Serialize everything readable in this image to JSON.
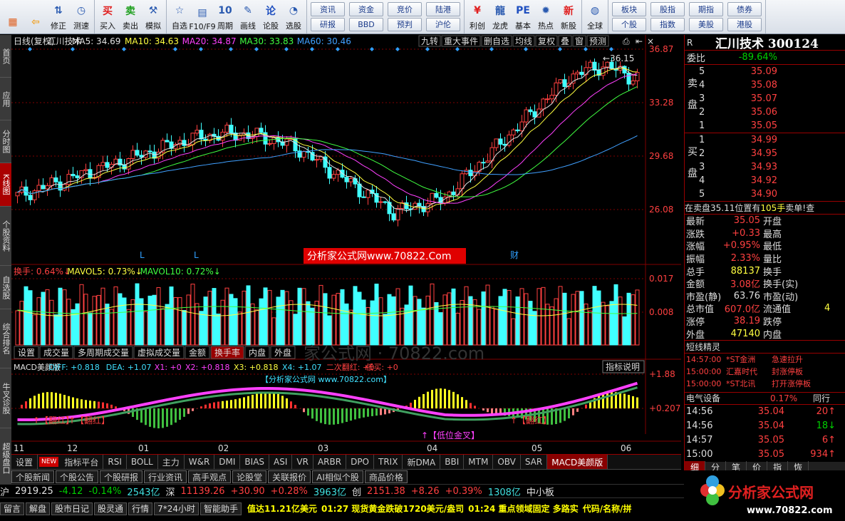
{
  "toolbar": {
    "buttons": [
      {
        "icon": "home-icon",
        "label": ""
      },
      {
        "icon": "back-icon",
        "label": ""
      },
      {
        "icon": "up-down-icon",
        "label": "修正"
      },
      {
        "icon": "test-icon",
        "label": "测速"
      },
      {
        "icon": "buy-icon",
        "label": "买入",
        "glyph": "买"
      },
      {
        "icon": "sell-icon",
        "label": "卖出",
        "glyph": "卖"
      },
      {
        "icon": "hammer-icon",
        "label": "模拟"
      },
      {
        "icon": "star-folder-icon",
        "label": "自选"
      },
      {
        "icon": "f10-icon",
        "label": "F10/F9"
      },
      {
        "icon": "calendar-icon",
        "label": "周期",
        "glyph": "10"
      },
      {
        "icon": "pencil-icon",
        "label": "画线"
      },
      {
        "icon": "forum-icon",
        "label": "论股",
        "glyph": "论"
      },
      {
        "icon": "chart-select-icon",
        "label": "选股"
      }
    ],
    "small_buttons": [
      [
        "资讯",
        "研报"
      ],
      [
        "资金",
        "BBD"
      ],
      [
        "竞价",
        "预判"
      ],
      [
        "陆港",
        "沪伦"
      ]
    ],
    "buttons2": [
      {
        "icon": "money-icon",
        "label": "利创",
        "glyph": "¥"
      },
      {
        "icon": "dragon-icon",
        "label": "龙虎"
      },
      {
        "icon": "pe-icon",
        "label": "基本",
        "glyph": "PE"
      },
      {
        "icon": "hot-icon",
        "label": "热点"
      },
      {
        "icon": "new-icon",
        "label": "新股",
        "glyph": "新"
      },
      {
        "icon": "globe-icon",
        "label": "全球"
      }
    ],
    "small_buttons2": [
      [
        "板块",
        "个股"
      ],
      [
        "股指",
        "指数"
      ],
      [
        "期指",
        "美股"
      ],
      [
        "债券",
        "港股"
      ]
    ]
  },
  "left_tabs": [
    "首页",
    "应用",
    "分时图",
    "K线图",
    "个股资料",
    "自选股",
    "综合排名",
    "牛叉诊股",
    "超级盘口"
  ],
  "chart": {
    "ma_line": [
      {
        "text": "日线(复权)",
        "color": "#e0e0e0"
      },
      {
        "text": "汇川技术",
        "color": "#e0e0e0"
      },
      {
        "text": "MA5: 34.69",
        "color": "#e0e0e0"
      },
      {
        "text": "MA10: 34.63",
        "color": "#ffff40"
      },
      {
        "text": "MA20: 34.87",
        "color": "#ff40ff"
      },
      {
        "text": "MA30: 33.83",
        "color": "#40ff40"
      },
      {
        "text": "MA60: 30.46",
        "color": "#40a0ff"
      }
    ],
    "top_buttons": [
      "九转",
      "重大事件",
      "删自选",
      "均线",
      "复权",
      "叠",
      "窗",
      "预测"
    ],
    "price_ticks": [
      "36.87",
      "33.28",
      "29.68",
      "26.08"
    ],
    "high_label": "36.15",
    "watermark": "分析家公式网www.70822.Com",
    "watermark2": "分析家公式网 www.70822.com",
    "markers": [
      "L",
      "L",
      "财"
    ],
    "vol_line": [
      {
        "text": "换手: 0.64%",
        "color": "#ff4040"
      },
      {
        "text": "MAVOL5: 0.73%",
        "color": "#ffff40"
      },
      {
        "text": "MAVOL10: 0.72%",
        "color": "#40ff40"
      }
    ],
    "vol_ticks": [
      "0.017",
      "0.008"
    ],
    "vol_tabs": [
      "设置",
      "成交量",
      "多周期成交量",
      "虚拟成交量",
      "金额",
      "换手率",
      "内盘",
      "外盘"
    ],
    "vol_tab_selected": "换手率",
    "macd_line": [
      {
        "text": "MACD美颜版",
        "color": "#e0e0e0"
      },
      {
        "text": "DIFF: +0.818",
        "color": "#40e0ff"
      },
      {
        "text": "DEA: +1.07",
        "color": "#40e0ff"
      },
      {
        "text": "X1: +0",
        "color": "#ff40ff"
      },
      {
        "text": "X2: +0.818",
        "color": "#ff40ff"
      },
      {
        "text": "X3: +0.818",
        "color": "#ffff40"
      },
      {
        "text": "X4: +1.07",
        "color": "#40e0ff"
      },
      {
        "text": "二次翻红: +0",
        "color": "#ff4040"
      },
      {
        "text": "低买: +0",
        "color": "#ff4040"
      }
    ],
    "macd_help": "指标说明",
    "macd_ticks": [
      "+1.88",
      "+0.207"
    ],
    "macd_labels": [
      "【翻红】",
      "【翻红】",
      "【低位金叉】",
      "【翻红】"
    ],
    "date_ticks": [
      "11",
      "12",
      "01",
      "02",
      "03",
      "04",
      "05",
      "06"
    ]
  },
  "indicator_tabs": [
    "设置",
    "NEW",
    "指标平台",
    "RSI",
    "BOLL",
    "主力",
    "W&R",
    "DMI",
    "BIAS",
    "ASI",
    "VR",
    "ARBR",
    "DPO",
    "TRIX",
    "新DMA",
    "BBI",
    "MTM",
    "OBV",
    "SAR",
    "MACD美颜版"
  ],
  "indicator_selected": "MACD美颜版",
  "news_tabs": [
    "个股新闻",
    "个股公告",
    "个股研报",
    "行业资讯",
    "高手观点",
    "论股堂",
    "关联报价",
    "AI相似个股",
    "商品价格"
  ],
  "index_bar": [
    {
      "text": "沪",
      "color": "#e0e0e0"
    },
    {
      "text": "2919.25",
      "color": "#e0e0e0"
    },
    {
      "text": "-4.12",
      "color": "#00d000"
    },
    {
      "text": "-0.14%",
      "color": "#00d000"
    },
    {
      "text": "2543亿",
      "color": "#40e0e0"
    },
    {
      "text": "深",
      "color": "#e0e0e0"
    },
    {
      "text": "11139.26",
      "color": "#ff4040"
    },
    {
      "text": "+30.90",
      "color": "#ff4040"
    },
    {
      "text": "+0.28%",
      "color": "#ff4040"
    },
    {
      "text": "3963亿",
      "color": "#40e0e0"
    },
    {
      "text": "创",
      "color": "#e0e0e0"
    },
    {
      "text": "2151.38",
      "color": "#ff4040"
    },
    {
      "text": "+8.26",
      "color": "#ff4040"
    },
    {
      "text": "+0.39%",
      "color": "#ff4040"
    },
    {
      "text": "1308亿",
      "color": "#40e0e0"
    },
    {
      "text": "中小板",
      "color": "#e0e0e0"
    }
  ],
  "bottom_bar": {
    "buttons": [
      "留言",
      "解盘",
      "股市日记",
      "股灵通",
      "行情",
      "7*24小时",
      "智能助手"
    ],
    "ticker": [
      "值达11.21亿美元",
      "01:27 现货黄金跌破1720美元/盎司",
      "01:24 重点领域固定 多路实",
      "代码/名称/拼"
    ]
  },
  "quote": {
    "title": "汇川技术 300124",
    "r_label": "R",
    "weibi_label": "委比",
    "weibi": "-89.64%",
    "sell_label": "卖盘",
    "sell": [
      {
        "lv": "5",
        "p": "35.09"
      },
      {
        "lv": "4",
        "p": "35.08"
      },
      {
        "lv": "3",
        "p": "35.07"
      },
      {
        "lv": "2",
        "p": "35.06"
      },
      {
        "lv": "1",
        "p": "35.05"
      }
    ],
    "buy_label": "买盘",
    "buy": [
      {
        "lv": "1",
        "p": "34.99"
      },
      {
        "lv": "2",
        "p": "34.95"
      },
      {
        "lv": "3",
        "p": "34.93"
      },
      {
        "lv": "4",
        "p": "34.92"
      },
      {
        "lv": "5",
        "p": "34.90"
      }
    ],
    "status": "在卖盘35.11位置有 105手 卖单!",
    "status_parts": [
      "在卖盘35.11位置有",
      "105手",
      "卖单!",
      "查"
    ],
    "stats": [
      [
        "最新",
        "35.05",
        "开盘",
        ""
      ],
      [
        "涨跌",
        "+0.33",
        "最高",
        ""
      ],
      [
        "涨幅",
        "+0.95%",
        "最低",
        ""
      ],
      [
        "振幅",
        "2.33%",
        "量比",
        ""
      ],
      [
        "总手",
        "88137",
        "换手",
        ""
      ],
      [
        "金额",
        "3.08亿",
        "换手(实)",
        ""
      ],
      [
        "市盈(静)",
        "63.76",
        "市盈(动)",
        ""
      ],
      [
        "总市值",
        "607.0亿",
        "流通值",
        "4"
      ],
      [
        "涨停",
        "38.19",
        "跌停",
        ""
      ],
      [
        "外盘",
        "47140",
        "内盘",
        ""
      ]
    ],
    "short_title": "短线精灵",
    "short": [
      {
        "t": "14:57:00",
        "s": "*ST金洲",
        "e": "急速拉升"
      },
      {
        "t": "15:00:00",
        "s": "汇嘉时代",
        "e": "封涨停板"
      },
      {
        "t": "15:00:00",
        "s": "*ST北讯",
        "e": "打开涨停板"
      }
    ],
    "sector": {
      "name": "电气设备",
      "pct": "0.17%",
      "extra": "同行"
    },
    "ticks": [
      {
        "t": "14:56",
        "p": "35.04",
        "v": "20",
        "d": "↑"
      },
      {
        "t": "14:56",
        "p": "35.04",
        "v": "18",
        "d": "↓"
      },
      {
        "t": "14:57",
        "p": "35.05",
        "v": "6",
        "d": "↑"
      },
      {
        "t": "15:00",
        "p": "35.05",
        "v": "934",
        "d": "↑"
      }
    ],
    "detail_tabs": [
      "细",
      "分",
      "笔",
      "价",
      "指",
      "恢"
    ]
  },
  "logo": {
    "text": "分析家公式网",
    "url": "www.70822.com"
  },
  "colors": {
    "up": "#ff4040",
    "down": "#40ffff",
    "bg": "#000000",
    "grid": "#800000"
  }
}
